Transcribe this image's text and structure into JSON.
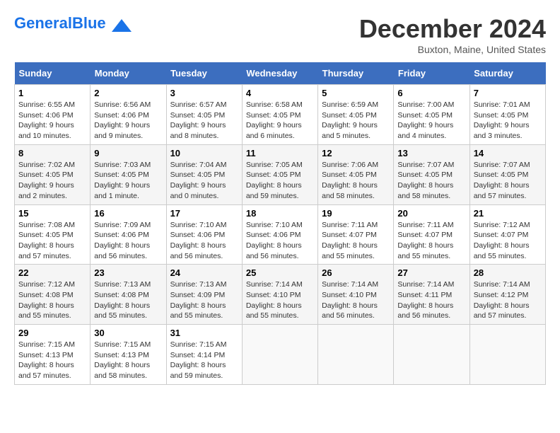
{
  "logo": {
    "text_general": "General",
    "text_blue": "Blue"
  },
  "title": "December 2024",
  "location": "Buxton, Maine, United States",
  "days_of_week": [
    "Sunday",
    "Monday",
    "Tuesday",
    "Wednesday",
    "Thursday",
    "Friday",
    "Saturday"
  ],
  "weeks": [
    [
      {
        "day": "1",
        "sunrise": "6:55 AM",
        "sunset": "4:06 PM",
        "daylight": "9 hours and 10 minutes."
      },
      {
        "day": "2",
        "sunrise": "6:56 AM",
        "sunset": "4:06 PM",
        "daylight": "9 hours and 9 minutes."
      },
      {
        "day": "3",
        "sunrise": "6:57 AM",
        "sunset": "4:05 PM",
        "daylight": "9 hours and 8 minutes."
      },
      {
        "day": "4",
        "sunrise": "6:58 AM",
        "sunset": "4:05 PM",
        "daylight": "9 hours and 6 minutes."
      },
      {
        "day": "5",
        "sunrise": "6:59 AM",
        "sunset": "4:05 PM",
        "daylight": "9 hours and 5 minutes."
      },
      {
        "day": "6",
        "sunrise": "7:00 AM",
        "sunset": "4:05 PM",
        "daylight": "9 hours and 4 minutes."
      },
      {
        "day": "7",
        "sunrise": "7:01 AM",
        "sunset": "4:05 PM",
        "daylight": "9 hours and 3 minutes."
      }
    ],
    [
      {
        "day": "8",
        "sunrise": "7:02 AM",
        "sunset": "4:05 PM",
        "daylight": "9 hours and 2 minutes."
      },
      {
        "day": "9",
        "sunrise": "7:03 AM",
        "sunset": "4:05 PM",
        "daylight": "9 hours and 1 minute."
      },
      {
        "day": "10",
        "sunrise": "7:04 AM",
        "sunset": "4:05 PM",
        "daylight": "9 hours and 0 minutes."
      },
      {
        "day": "11",
        "sunrise": "7:05 AM",
        "sunset": "4:05 PM",
        "daylight": "8 hours and 59 minutes."
      },
      {
        "day": "12",
        "sunrise": "7:06 AM",
        "sunset": "4:05 PM",
        "daylight": "8 hours and 58 minutes."
      },
      {
        "day": "13",
        "sunrise": "7:07 AM",
        "sunset": "4:05 PM",
        "daylight": "8 hours and 58 minutes."
      },
      {
        "day": "14",
        "sunrise": "7:07 AM",
        "sunset": "4:05 PM",
        "daylight": "8 hours and 57 minutes."
      }
    ],
    [
      {
        "day": "15",
        "sunrise": "7:08 AM",
        "sunset": "4:05 PM",
        "daylight": "8 hours and 57 minutes."
      },
      {
        "day": "16",
        "sunrise": "7:09 AM",
        "sunset": "4:06 PM",
        "daylight": "8 hours and 56 minutes."
      },
      {
        "day": "17",
        "sunrise": "7:10 AM",
        "sunset": "4:06 PM",
        "daylight": "8 hours and 56 minutes."
      },
      {
        "day": "18",
        "sunrise": "7:10 AM",
        "sunset": "4:06 PM",
        "daylight": "8 hours and 56 minutes."
      },
      {
        "day": "19",
        "sunrise": "7:11 AM",
        "sunset": "4:07 PM",
        "daylight": "8 hours and 55 minutes."
      },
      {
        "day": "20",
        "sunrise": "7:11 AM",
        "sunset": "4:07 PM",
        "daylight": "8 hours and 55 minutes."
      },
      {
        "day": "21",
        "sunrise": "7:12 AM",
        "sunset": "4:07 PM",
        "daylight": "8 hours and 55 minutes."
      }
    ],
    [
      {
        "day": "22",
        "sunrise": "7:12 AM",
        "sunset": "4:08 PM",
        "daylight": "8 hours and 55 minutes."
      },
      {
        "day": "23",
        "sunrise": "7:13 AM",
        "sunset": "4:08 PM",
        "daylight": "8 hours and 55 minutes."
      },
      {
        "day": "24",
        "sunrise": "7:13 AM",
        "sunset": "4:09 PM",
        "daylight": "8 hours and 55 minutes."
      },
      {
        "day": "25",
        "sunrise": "7:14 AM",
        "sunset": "4:10 PM",
        "daylight": "8 hours and 55 minutes."
      },
      {
        "day": "26",
        "sunrise": "7:14 AM",
        "sunset": "4:10 PM",
        "daylight": "8 hours and 56 minutes."
      },
      {
        "day": "27",
        "sunrise": "7:14 AM",
        "sunset": "4:11 PM",
        "daylight": "8 hours and 56 minutes."
      },
      {
        "day": "28",
        "sunrise": "7:14 AM",
        "sunset": "4:12 PM",
        "daylight": "8 hours and 57 minutes."
      }
    ],
    [
      {
        "day": "29",
        "sunrise": "7:15 AM",
        "sunset": "4:13 PM",
        "daylight": "8 hours and 57 minutes."
      },
      {
        "day": "30",
        "sunrise": "7:15 AM",
        "sunset": "4:13 PM",
        "daylight": "8 hours and 58 minutes."
      },
      {
        "day": "31",
        "sunrise": "7:15 AM",
        "sunset": "4:14 PM",
        "daylight": "8 hours and 59 minutes."
      },
      null,
      null,
      null,
      null
    ]
  ]
}
